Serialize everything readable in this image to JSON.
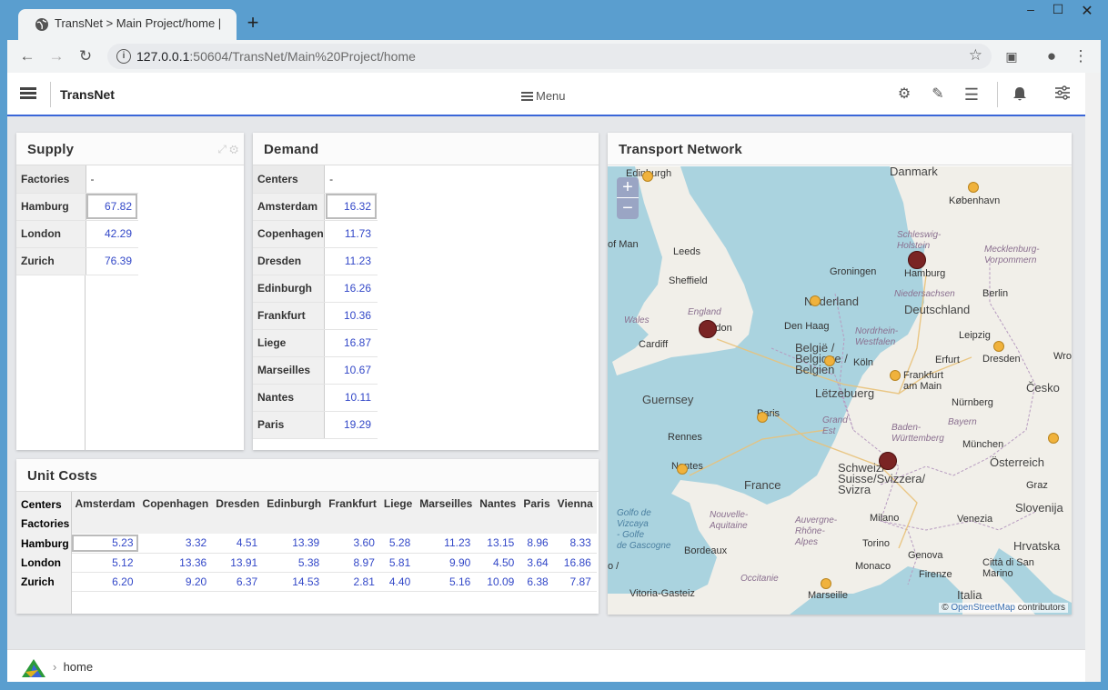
{
  "browser": {
    "tab_title": "TransNet > Main Project/home |",
    "url_host": "127.0.0.1",
    "url_rest": ":50604/TransNet/Main%20Project/home"
  },
  "app": {
    "title": "TransNet",
    "menu_label": "Menu"
  },
  "supply": {
    "title": "Supply",
    "header": [
      "Factories",
      "-"
    ],
    "rows": [
      {
        "name": "Hamburg",
        "value": "67.82"
      },
      {
        "name": "London",
        "value": "42.29"
      },
      {
        "name": "Zurich",
        "value": "76.39"
      }
    ]
  },
  "demand": {
    "title": "Demand",
    "header": [
      "Centers",
      "-"
    ],
    "rows": [
      {
        "name": "Amsterdam",
        "value": "16.32"
      },
      {
        "name": "Copenhagen",
        "value": "11.73"
      },
      {
        "name": "Dresden",
        "value": "11.23"
      },
      {
        "name": "Edinburgh",
        "value": "16.26"
      },
      {
        "name": "Frankfurt",
        "value": "10.36"
      },
      {
        "name": "Liege",
        "value": "16.87"
      },
      {
        "name": "Marseilles",
        "value": "10.67"
      },
      {
        "name": "Nantes",
        "value": "10.11"
      },
      {
        "name": "Paris",
        "value": "19.29"
      }
    ]
  },
  "costs": {
    "title": "Unit Costs",
    "row_header_top": "Centers",
    "row_header_bottom": "Factories",
    "columns": [
      "Amsterdam",
      "Copenhagen",
      "Dresden",
      "Edinburgh",
      "Frankfurt",
      "Liege",
      "Marseilles",
      "Nantes",
      "Paris",
      "Vienna"
    ],
    "rows": [
      {
        "name": "Hamburg",
        "values": [
          "5.23",
          "3.32",
          "4.51",
          "13.39",
          "3.60",
          "5.28",
          "11.23",
          "13.15",
          "8.96",
          "8.33"
        ]
      },
      {
        "name": "London",
        "values": [
          "5.12",
          "13.36",
          "13.91",
          "5.38",
          "8.97",
          "5.81",
          "9.90",
          "4.50",
          "3.64",
          "16.86"
        ]
      },
      {
        "name": "Zurich",
        "values": [
          "6.20",
          "9.20",
          "6.37",
          "14.53",
          "2.81",
          "4.40",
          "5.16",
          "10.09",
          "6.38",
          "7.87"
        ]
      }
    ]
  },
  "map": {
    "title": "Transport Network",
    "zoom_in": "+",
    "zoom_out": "−",
    "attribution_prefix": "©",
    "attribution_link": "OpenStreetMap",
    "attribution_suffix": "contributors",
    "labels": [
      "Edinburgh",
      "Danmark",
      "København",
      "of Man",
      "Leeds",
      "Sheffield",
      "Schleswig-\nHolstein",
      "Mecklenburg-\nVorpommern",
      "Groningen",
      "Hamburg",
      "Niedersachsen",
      "Berlin",
      "Nederland",
      "England",
      "Deutschland",
      "Wales",
      "London",
      "Den Haag",
      "Nordrhein-\nWestfalen",
      "Leipzig",
      "Cardiff",
      "België /\nBelgique /\nBelgien",
      "Köln",
      "Erfurt",
      "Dresden",
      "Wro",
      "Frankfurt\nam Main",
      "Guernsey",
      "Lëtzebuerg",
      "Česko",
      "Nürnberg",
      "Paris",
      "Grand\nEst",
      "Bayern",
      "Rennes",
      "Baden-\nWürttemberg",
      "München",
      "Nantes",
      "Schweiz/\nSuisse/Svizzera/\nSvizra",
      "Österreich",
      "France",
      "Graz",
      "Golfo de\nVizcaya\n- Golfe\nde Gascogne",
      "Nouvelle-\nAquitaine",
      "Auvergne-\nRhône-\nAlpes",
      "Milano",
      "Venezia",
      "Slovenija",
      "Bordeaux",
      "Torino",
      "Hrvatska",
      "Genova",
      "Monaco",
      "Firenze",
      "Città di San\nMarino",
      "o /",
      "Occitanie",
      "Vitoria-Gasteiz",
      "Marseille",
      "Italia"
    ]
  },
  "footer": {
    "breadcrumb": "home"
  },
  "colors": {
    "accent": "#3a66d8",
    "value_text": "#3348c8",
    "center_dot": "#f0b23c",
    "factory_dot": "#7a2424",
    "water": "#aad3df"
  }
}
